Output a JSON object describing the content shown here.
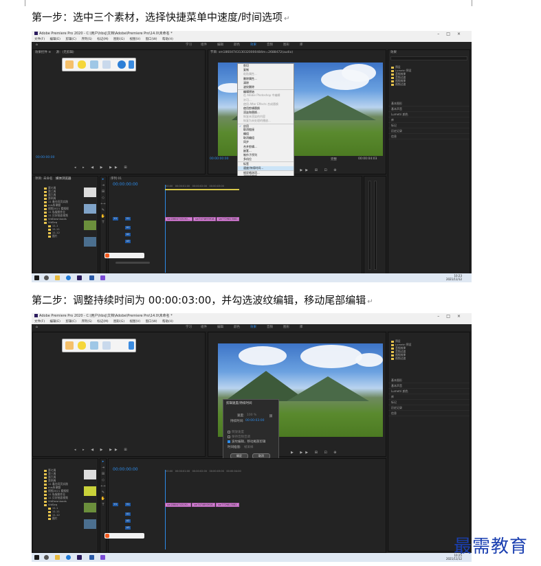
{
  "captions": {
    "step1": "第一步：选中三个素材，选择快捷菜单中速度/时间选项",
    "step2": "第二步：调整持续时间为 00:00:03:00，并勾选波纹编辑，移动尾部编辑"
  },
  "app": {
    "title": "Adobe Premiere Pro 2020 - C:\\用户\\hbsj\\文档\\Adobe\\Premiere Pro\\14.0\\未命名 *",
    "menu": [
      "文件(F)",
      "编辑(E)",
      "剪辑(C)",
      "序列(S)",
      "标记(M)",
      "图形(G)",
      "视图(V)",
      "窗口(W)",
      "帮助(H)"
    ],
    "workspaces": [
      "学习",
      "组件",
      "编辑",
      "颜色",
      "效果",
      "音频",
      "图形",
      "库"
    ],
    "active_workspace": "效果"
  },
  "shot1": {
    "source_timecode": "00:00:00:00",
    "program_timecode": "00:00:00:00",
    "program_end_timecode": "00:00:04:03",
    "fit_label": "完整",
    "sequence_timecode": "00:00:00:00",
    "sequence_tab": "序列 01",
    "program_title": "节目: sm18604743130320000484m=2688472(audio)",
    "project_tab": "项目: 未命名",
    "media_browser_tab": "媒体浏览器",
    "bins": [
      "第七周",
      "第三周",
      "第六周",
      "第四周",
      "11 春仓同页实践",
      "mis所课题",
      "视频2021 看搜视",
      "11 私服图作业",
      "11 贝好拍面视频",
      "VidDownloads",
      "VidSeq",
      "11.1",
      "11.11",
      "11.12",
      "图片"
    ],
    "context_menu": [
      {
        "label": "剪切",
        "state": "normal"
      },
      {
        "label": "复制",
        "state": "normal"
      },
      {
        "label": "粘贴属性...",
        "state": "dim"
      },
      {
        "label": "删除属性...",
        "state": "normal"
      },
      {
        "label": "清除",
        "state": "normal"
      },
      {
        "label": "波纹删除",
        "state": "normal"
      },
      {
        "label": "编辑原始",
        "state": "sep"
      },
      {
        "label": "在 Adobe Photoshop 中编辑",
        "state": "dim"
      },
      {
        "label": "许可...",
        "state": "dim"
      },
      {
        "label": "使用 After Effects 合成替换",
        "state": "dim"
      },
      {
        "label": "使用剪辑替换",
        "state": "normal"
      },
      {
        "label": "渲染和替换...",
        "state": "normal"
      },
      {
        "label": "恢复未渲染的内容",
        "state": "dim"
      },
      {
        "label": "恢复为未处理的播放...",
        "state": "dim"
      },
      {
        "label": "启用",
        "state": "sep"
      },
      {
        "label": "取消链接",
        "state": "normal"
      },
      {
        "label": "编组",
        "state": "normal"
      },
      {
        "label": "取消编组",
        "state": "normal"
      },
      {
        "label": "同步",
        "state": "normal"
      },
      {
        "label": "合并剪辑...",
        "state": "normal"
      },
      {
        "label": "嵌套...",
        "state": "normal"
      },
      {
        "label": "制作子序列",
        "state": "normal"
      },
      {
        "label": "多机位",
        "state": "normal"
      },
      {
        "label": "标签",
        "state": "sep"
      },
      {
        "label": "速度/持续时间...",
        "state": "hl"
      },
      {
        "label": "帧定格选项...",
        "state": "sep"
      },
      {
        "label": "添加帧定格",
        "state": "normal"
      },
      {
        "label": "插入帧定格分段",
        "state": "normal"
      },
      {
        "label": "场选项...",
        "state": "normal"
      },
      {
        "label": "时间插值",
        "state": "normal"
      },
      {
        "label": "缩放为帧大小",
        "state": "normal"
      },
      {
        "label": "设为帧大小",
        "state": "normal"
      },
      {
        "label": "调整图层",
        "state": "normal"
      },
      {
        "label": "链接媒体...",
        "state": "sep"
      },
      {
        "label": "设为脱机...",
        "state": "normal"
      },
      {
        "label": "重命名...",
        "state": "sep"
      },
      {
        "label": "在项目中显示",
        "state": "normal"
      },
      {
        "label": "在资源管理器中显示...",
        "state": "normal"
      },
      {
        "label": "属性",
        "state": "sep"
      }
    ],
    "clips": [
      "sm18604743130...",
      "sm7474693916...",
      "sm7729813082..."
    ],
    "effects_panel_title": "效果",
    "effects_items": [
      "预设",
      "Lumetri 预设",
      "音频效果",
      "音频过渡",
      "视频效果",
      "视频过渡"
    ],
    "right_sections": [
      "基本图形",
      "基本声音",
      "Lumetri 颜色",
      "库",
      "标记",
      "历史记录",
      "信息"
    ],
    "clock_time": "10:23",
    "clock_date": "2021/11/12"
  },
  "shot2": {
    "dialog_title": "剪辑速度/持续时间",
    "speed_label": "速度:",
    "speed_value": "100 %",
    "duration_label": "持续时间:",
    "duration_value": "00:00:03:00",
    "reverse_label": "倒放速度",
    "keep_pitch_label": "保持音频音调",
    "ripple_label": "波纹编辑，移动尾部剪辑",
    "interp_label": "时间插值:",
    "interp_value": "帧采样",
    "ok_label": "确定",
    "cancel_label": "取消",
    "sequence_timecode": "00:00:00:00",
    "clock_time": "10:25",
    "clock_date": "2021/11/12"
  },
  "watermark": "最需教育",
  "colors": {
    "accent_blue": "#2d8ceb",
    "clip_pink": "#d580d5",
    "menu_highlight": "#cce4f7"
  }
}
